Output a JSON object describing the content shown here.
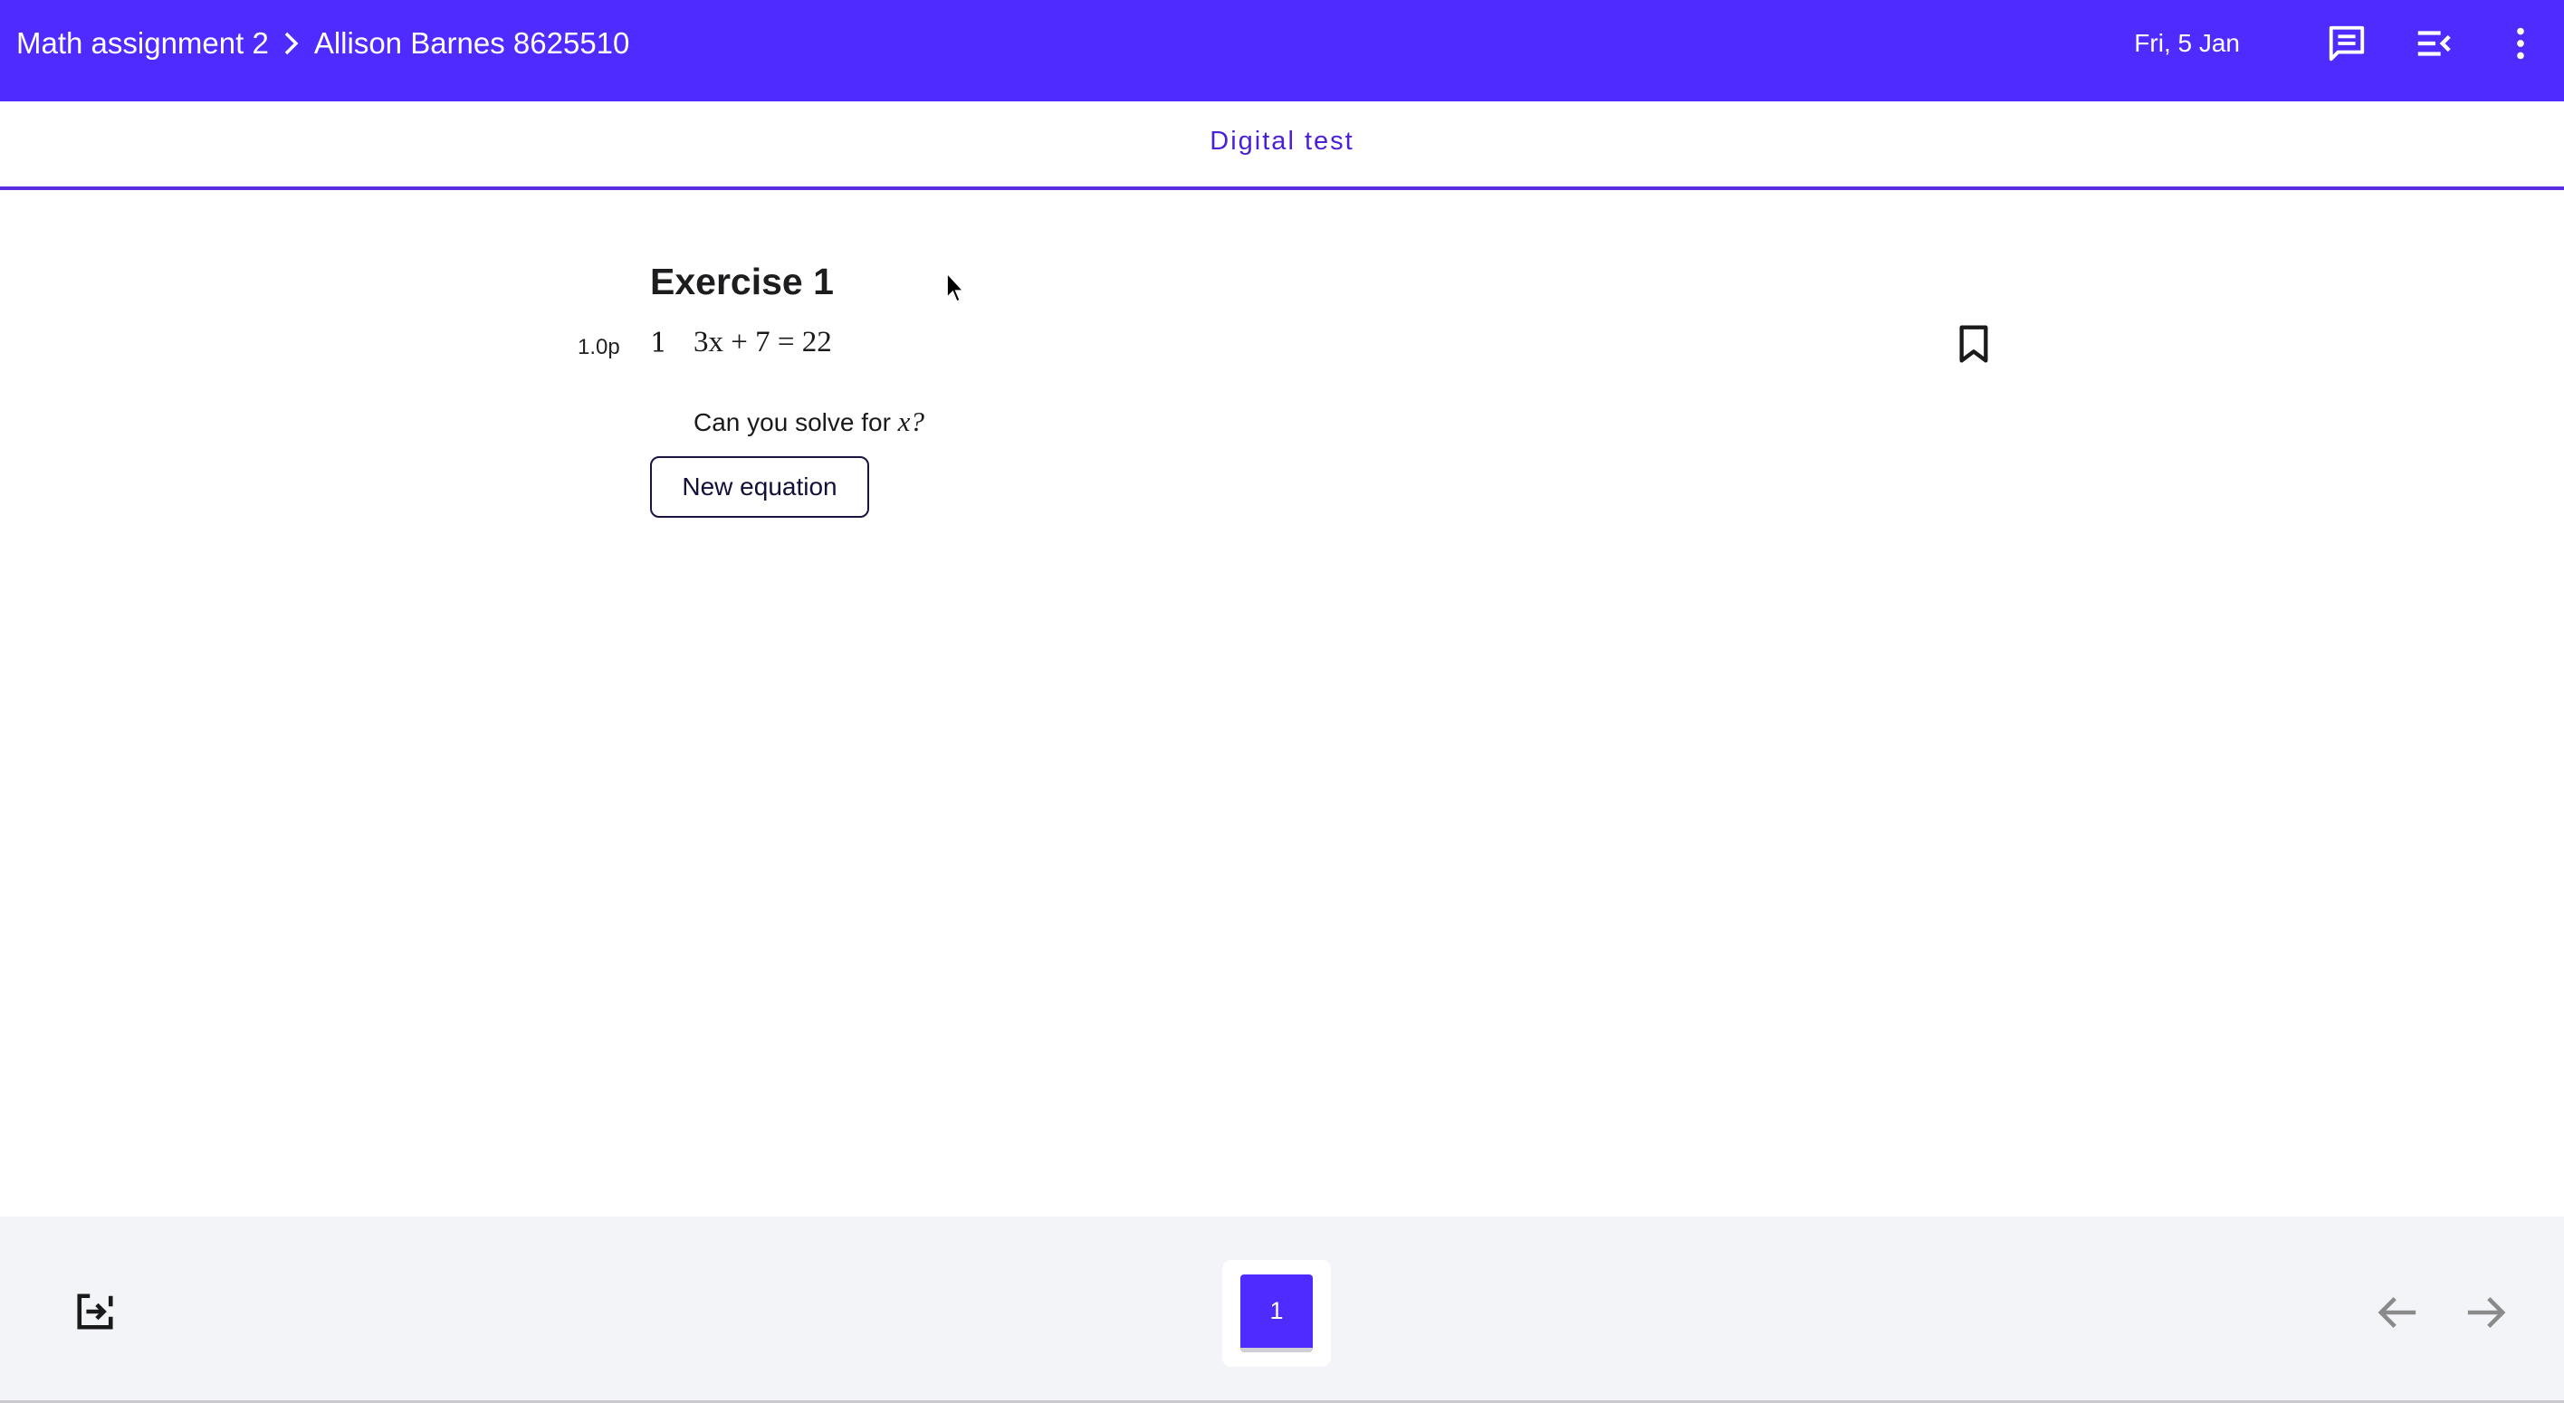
{
  "header": {
    "assignment": "Math assignment 2",
    "student": "Allison Barnes 8625510",
    "date": "Fri, 5 Jan",
    "icons": [
      "chevron-right-icon",
      "comment-icon",
      "collapse-menu-icon",
      "more-vert-icon"
    ]
  },
  "tabs": {
    "active": "Digital test"
  },
  "exercise": {
    "title": "Exercise 1",
    "points": "1.0p",
    "question_number": "1",
    "equation": "3x + 7 = 22",
    "prompt_text": "Can you solve for ",
    "prompt_var": "x",
    "prompt_end": "?",
    "new_equation_label": "New equation"
  },
  "footer": {
    "pages": [
      "1"
    ],
    "current_page": "1",
    "icons": [
      "exit-icon",
      "arrow-left-icon",
      "arrow-right-icon"
    ]
  },
  "colors": {
    "brand": "#4f2bff",
    "tab_accent": "#5a2de0",
    "footer_bg": "#f3f4f7"
  }
}
